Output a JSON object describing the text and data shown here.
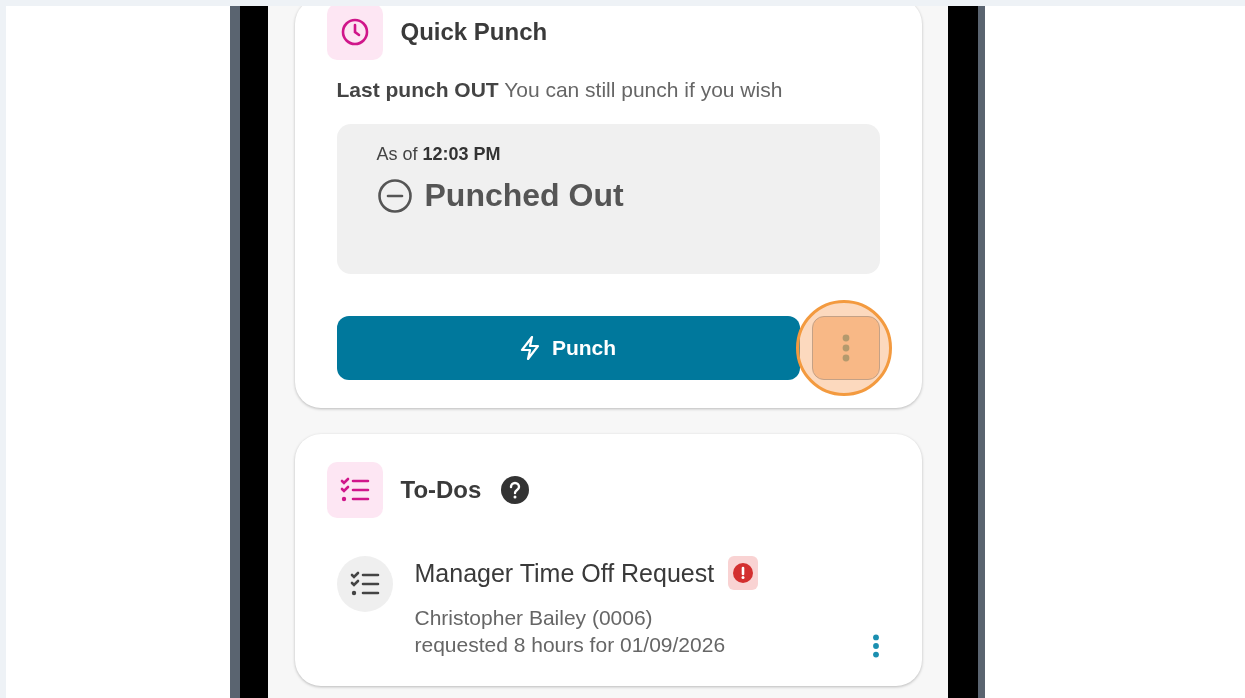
{
  "quick_punch": {
    "title": "Quick Punch",
    "status_line": "**Last punch OUT** You can still punch if you wish",
    "as_of": "As of **12:03 PM**",
    "status": "Punched Out",
    "punch_button": "Punch",
    "more_highlighted": true
  },
  "todos": {
    "title": "To-Dos",
    "items": [
      {
        "title": "Manager Time Off Request",
        "alert": true,
        "lines": [
          "Christopher Bailey (0006)",
          "requested 8 hours for 01/09/2026"
        ]
      }
    ]
  }
}
